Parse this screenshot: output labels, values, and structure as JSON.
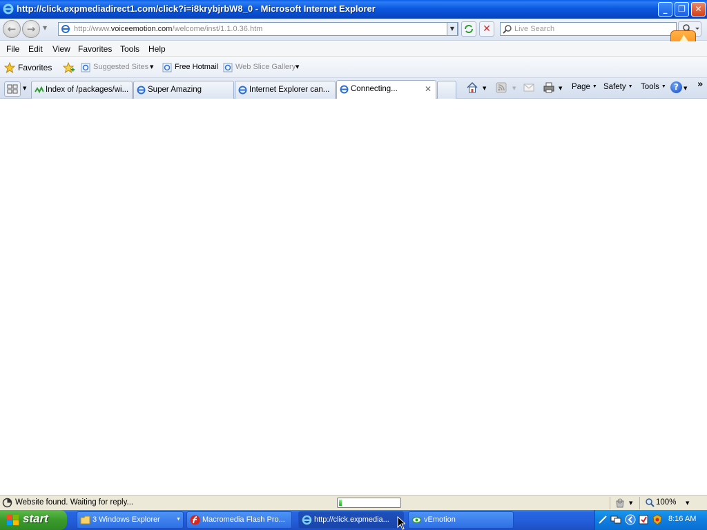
{
  "window": {
    "title": "http://click.expmediadirect1.com/click?i=i8krybjrbW8_0 - Microsoft Internet Explorer",
    "minimize": "_",
    "restore": "❐",
    "close": "✕"
  },
  "address": {
    "url_prefix": "http://www.",
    "url_domain": "voiceemotion.com",
    "url_path": "/welcome/inst/1.1.0.36.htm",
    "search_placeholder": "Live Search"
  },
  "menu": [
    "File",
    "Edit",
    "View",
    "Favorites",
    "Tools",
    "Help"
  ],
  "favorites": {
    "label": "Favorites",
    "suggested_sites": "Suggested Sites",
    "free_hotmail": "Free Hotmail",
    "web_slice_gallery": "Web Slice Gallery"
  },
  "tabs": [
    {
      "label": "Index of /packages/wi..."
    },
    {
      "label": "Super Amazing"
    },
    {
      "label": "Internet Explorer can..."
    },
    {
      "label": "Connecting..."
    }
  ],
  "toolbar": {
    "page": "Page",
    "safety": "Safety",
    "tools": "Tools",
    "more": "»"
  },
  "status": {
    "text": "Website found. Waiting for reply...",
    "progress": 0.05,
    "zoom": "100%"
  },
  "taskbar": {
    "start": "start",
    "tasks": [
      {
        "label": "3 Windows Explorer"
      },
      {
        "label": "Macromedia Flash Pro..."
      },
      {
        "label": "http://click.expmedia..."
      },
      {
        "label": "vEmotion"
      }
    ],
    "clock": "8:16 AM"
  },
  "colors": {
    "titlebar_blue": "#0a5fe8",
    "taskbar_blue": "#245edb",
    "start_green": "#3a9a2c",
    "progress_green": "#22b022"
  }
}
